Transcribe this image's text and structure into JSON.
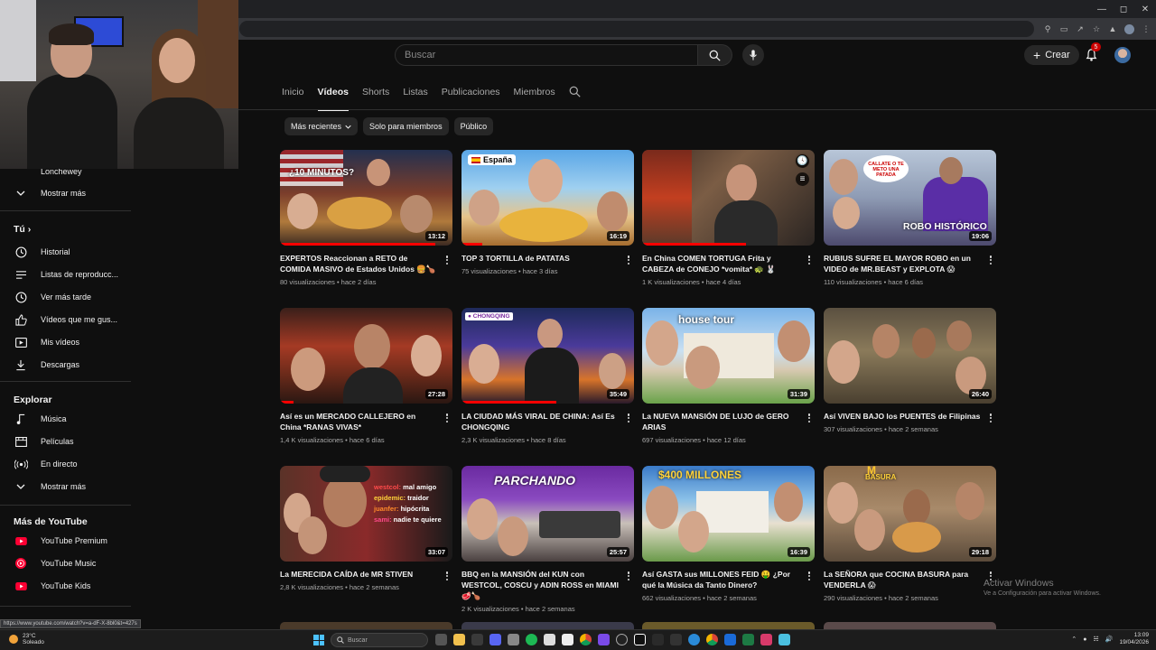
{
  "masthead": {
    "search_placeholder": "Buscar",
    "create_label": "Crear",
    "notification_count": "5"
  },
  "sidebar": {
    "partial_channel": "Lonchewey",
    "show_more_1": "Mostrar más",
    "you_header": "Tú",
    "you_items": [
      "Historial",
      "Listas de reproducc...",
      "Ver más tarde",
      "Vídeos que me gus...",
      "Mis vídeos",
      "Descargas"
    ],
    "explore_header": "Explorar",
    "explore_items": [
      "Música",
      "Películas",
      "En directo",
      "Mostrar más"
    ],
    "more_header": "Más de YouTube",
    "more_items": [
      "YouTube Premium",
      "YouTube Music",
      "YouTube Kids"
    ]
  },
  "tabs": [
    "Inicio",
    "Vídeos",
    "Shorts",
    "Listas",
    "Publicaciones",
    "Miembros"
  ],
  "chips": [
    "Más recientes",
    "Solo para miembros",
    "Público"
  ],
  "videos": [
    {
      "title": "EXPERTOS Reaccionan a RETO de COMIDA MASIVO de Estados Unidos 🍔🍗",
      "views": "80 visualizaciones",
      "age": "hace 2 días",
      "duration": "13:12",
      "overlay": "¿10 MINUTOS?"
    },
    {
      "title": "TOP 3 TORTILLA de PATATAS",
      "views": "75 visualizaciones",
      "age": "hace 3 días",
      "duration": "16:19",
      "overlay": "España"
    },
    {
      "title": "En China COMEN TORTUGA Frita y CABEZA de CONEJO *vomita* 🐢 🐰",
      "views": "1 K visualizaciones",
      "age": "hace 4 días",
      "duration": "",
      "overlay": ""
    },
    {
      "title": "RUBIUS SUFRE EL MAYOR ROBO en un VIDEO de MR.BEAST y EXPLOTA 😱",
      "views": "110 visualizaciones",
      "age": "hace 6 días",
      "duration": "19:06",
      "overlay": "ROBO HISTÓRICO"
    },
    {
      "title": "Así es un MERCADO CALLEJERO en China *RANAS VIVAS*",
      "views": "1,4 K visualizaciones",
      "age": "hace 6 días",
      "duration": "27:28",
      "overlay": ""
    },
    {
      "title": "LA CIUDAD MÁS VIRAL DE CHINA: Así Es CHONGQING",
      "views": "2,3 K visualizaciones",
      "age": "hace 8 días",
      "duration": "35:49",
      "overlay": "CHONGQING"
    },
    {
      "title": "La NUEVA MANSIÓN DE LUJO de GERO ARIAS",
      "views": "697 visualizaciones",
      "age": "hace 12 días",
      "duration": "31:39",
      "overlay": "house tour"
    },
    {
      "title": "Así VIVEN BAJO los PUENTES de Filipinas",
      "views": "307 visualizaciones",
      "age": "hace 2 semanas",
      "duration": "26:40",
      "overlay": ""
    },
    {
      "title": "La MERECIDA CAÍDA de MR STIVEN",
      "views": "2,8 K visualizaciones",
      "age": "hace 2 semanas",
      "duration": "33:07",
      "overlay": ""
    },
    {
      "title": "BBQ en la MANSIÓN del KUN con WESTCOL, COSCU y ADIN ROSS en MIAMI 🥩🍗",
      "views": "2 K visualizaciones",
      "age": "hace 2 semanas",
      "duration": "25:57",
      "overlay": "PARCHANDO"
    },
    {
      "title": "Así GASTA sus MILLONES FEID 🤑 ¿Por qué la Música da Tanto Dinero?",
      "views": "662 visualizaciones",
      "age": "hace 2 semanas",
      "duration": "16:39",
      "overlay": "$400 MILLONES"
    },
    {
      "title": "La SEÑORA que COCINA BASURA para VENDERLA 😱",
      "views": "290 visualizaciones",
      "age": "hace 2 semanas",
      "duration": "29:18",
      "overlay": "BASURA"
    }
  ],
  "stiven_lines": [
    "westcol: mal amigo",
    "epidemic: traidor",
    "juanfer: hipócrita",
    "sami: nadie te quiere"
  ],
  "thumb4_callout": "CALLATE O TE METO UNA PATADA",
  "activation": {
    "line1": "Activar Windows",
    "line2": "Ve a Configuración para activar Windows."
  },
  "status_url": "https://www.youtube.com/watch?v=a-dF-X-8bl0&t=427s",
  "taskbar": {
    "weather_temp": "23°C",
    "weather_desc": "Soleado",
    "search_placeholder": "Buscar",
    "time": "13:09",
    "date": "19/04/2026"
  },
  "colors": {
    "accent": "#ff0000",
    "background": "#0f0f0f",
    "chip": "#272727",
    "badge": "#cc0000"
  }
}
